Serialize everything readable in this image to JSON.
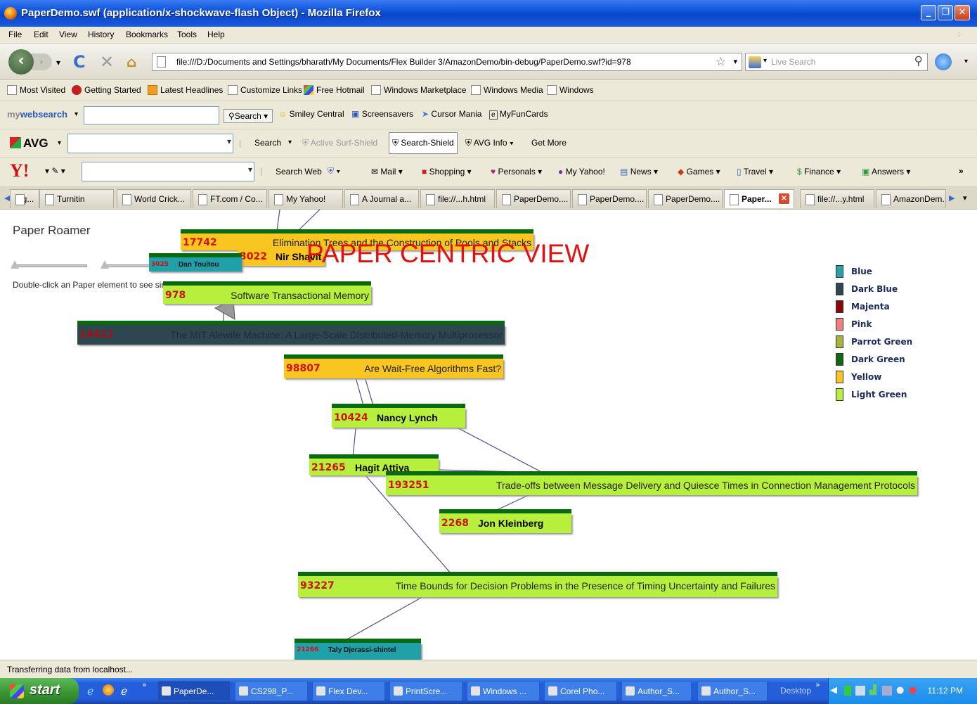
{
  "window": {
    "title": "PaperDemo.swf (application/x-shockwave-flash Object) - Mozilla Firefox",
    "min_icon": "minimize-icon",
    "max_icon": "maximize-icon",
    "close_icon": "close-icon"
  },
  "menu": [
    "File",
    "Edit",
    "View",
    "History",
    "Bookmarks",
    "Tools",
    "Help"
  ],
  "nav": {
    "url": "file:///D:/Documents and Settings/bharath/My Documents/Flex Builder 3/AmazonDemo/bin-debug/PaperDemo.swf?id=978",
    "search_placeholder": "Live Search"
  },
  "bookmarks": [
    "Most Visited",
    "Getting Started",
    "Latest Headlines",
    "Customize Links",
    "Free Hotmail",
    "Windows Marketplace",
    "Windows Media",
    "Windows"
  ],
  "mywebsearch": {
    "brand_a": "my",
    "brand_b": "websearch",
    "items": [
      "Search",
      "Smiley Central",
      "Screensavers",
      "Cursor Mania",
      "MyFunCards"
    ]
  },
  "avg": {
    "brand": "AVG",
    "items": [
      "Search",
      "Active Surf-Shield",
      "Search-Shield",
      "AVG Info",
      "Get More"
    ]
  },
  "yahoo": {
    "brand": "Y!",
    "items": [
      "Search Web",
      "Mail",
      "Shopping",
      "Personals",
      "My Yahoo!",
      "News",
      "Games",
      "Travel",
      "Finance",
      "Answers"
    ],
    "more": "»"
  },
  "tabs": [
    "ng...",
    "Turnitin",
    "World Crick...",
    "FT.com / Co...",
    "My Yahoo!",
    "A Journal a...",
    "file://...h.html",
    "PaperDemo....",
    "PaperDemo....",
    "PaperDemo....",
    "Paper...",
    "file://...y.html",
    "AmazonDem..."
  ],
  "app": {
    "name": "Paper Roamer",
    "hint": "Double-click an Paper element to see similar items",
    "view_title": "PAPER CENTRIC VIEW"
  },
  "nodes": [
    {
      "id": "17742",
      "text": "Elimination Trees and the Construction of Pools and Stacks",
      "color": "#f9c520",
      "kind": "paper"
    },
    {
      "id": "3022",
      "text": "Nir Shavit",
      "color": "#f9c520",
      "kind": "author"
    },
    {
      "id": "3025",
      "text": "Dan Touitou",
      "color": "#20a0a8",
      "kind": "author"
    },
    {
      "id": "978",
      "text": "Software Transactional Memory",
      "color": "#b6f03c",
      "kind": "paper"
    },
    {
      "id": "14421",
      "text": "The MIT Alewife Machine: A Large-Scale Distributed-Memory Multiprocessor",
      "color": "#2e4650",
      "kind": "paper"
    },
    {
      "id": "98807",
      "text": "Are Wait-Free Algorithms Fast?",
      "color": "#f9c520",
      "kind": "paper"
    },
    {
      "id": "10424",
      "text": "Nancy Lynch",
      "color": "#b6f03c",
      "kind": "author"
    },
    {
      "id": "21265",
      "text": "Hagit Attiya",
      "color": "#b6f03c",
      "kind": "author"
    },
    {
      "id": "193251",
      "text": "Trade-offs between Message Delivery and Quiesce Times in Connection Management Protocols",
      "color": "#b6f03c",
      "kind": "paper"
    },
    {
      "id": "2268",
      "text": "Jon Kleinberg",
      "color": "#b6f03c",
      "kind": "author"
    },
    {
      "id": "93227",
      "text": "Time Bounds for Decision Problems in the Presence of Timing Uncertainty and Failures",
      "color": "#b6f03c",
      "kind": "paper"
    },
    {
      "id": "21266",
      "text": "Taly Djerassi-shintel",
      "color": "#20a0a8",
      "kind": "author"
    }
  ],
  "legend": [
    {
      "label": "Blue",
      "color": "#2aa0a8"
    },
    {
      "label": "Dark Blue",
      "color": "#2e4650"
    },
    {
      "label": "Majenta",
      "color": "#8a0808"
    },
    {
      "label": "Pink",
      "color": "#f08080"
    },
    {
      "label": "Parrot Green",
      "color": "#a8b440"
    },
    {
      "label": "Dark Green",
      "color": "#0a6a10"
    },
    {
      "label": "Yellow",
      "color": "#f9c520"
    },
    {
      "label": "Light Green",
      "color": "#b6f03c"
    }
  ],
  "status": "Transferring data from localhost...",
  "taskbar": {
    "start": "start",
    "items": [
      "PaperDe...",
      "CS298_P...",
      "Flex Dev...",
      "PrintScre...",
      "Windows ...",
      "Corel Pho...",
      "Author_S...",
      "Author_S..."
    ],
    "desktop": "Desktop",
    "clock": "11:12 PM"
  }
}
